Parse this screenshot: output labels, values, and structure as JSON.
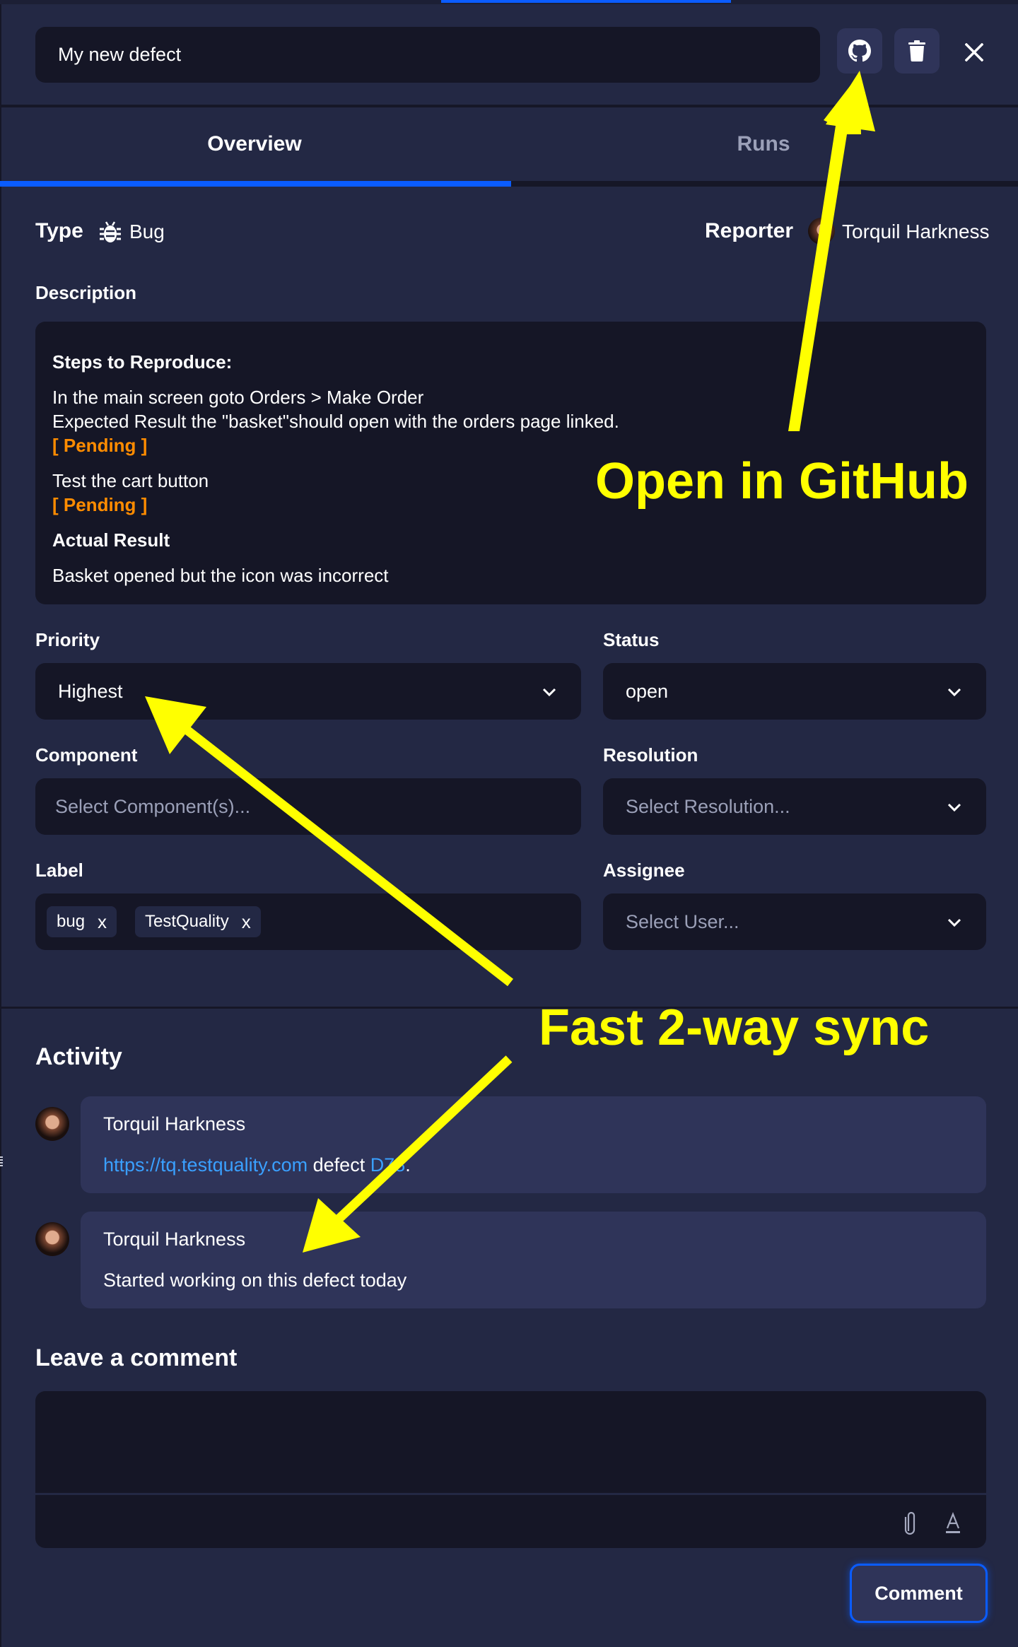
{
  "header": {
    "title_value": "My new defect",
    "github_button": "github-icon",
    "delete_button": "trash-icon",
    "close_button": "close-icon"
  },
  "tabs": [
    {
      "label": "Overview",
      "active": true
    },
    {
      "label": "Runs",
      "active": false
    }
  ],
  "overview": {
    "type_label": "Type",
    "type_value": "Bug",
    "type_icon": "bug-icon",
    "reporter_label": "Reporter",
    "reporter_name": "Torquil Harkness",
    "description_label": "Description",
    "description": {
      "steps_heading": "Steps to Reproduce:",
      "step1_line1": "In the main screen goto Orders > Make Order",
      "step1_line2": "Expected Result the \"basket\"should open with the orders page linked.",
      "step1_status": "[ Pending ]",
      "step2_line1": "Test the cart button",
      "step2_status": "[ Pending ]",
      "actual_heading": "Actual Result",
      "actual_text": "Basket opened but the icon was incorrect"
    },
    "fields": {
      "priority": {
        "label": "Priority",
        "value": "Highest"
      },
      "status": {
        "label": "Status",
        "value": "open"
      },
      "component": {
        "label": "Component",
        "placeholder": "Select Component(s)..."
      },
      "resolution": {
        "label": "Resolution",
        "placeholder": "Select Resolution..."
      },
      "label": {
        "label": "Label",
        "chips": [
          "bug",
          "TestQuality"
        ],
        "remove_glyph": "x"
      },
      "assignee": {
        "label": "Assignee",
        "placeholder": "Select User..."
      }
    }
  },
  "activity": {
    "title": "Activity",
    "items": [
      {
        "author": "Torquil Harkness",
        "link_text": "https://tq.testquality.com",
        "middle_text": " defect ",
        "ref": "D78",
        "tail": "."
      },
      {
        "author": "Torquil Harkness",
        "text": "Started working on this defect today"
      }
    ]
  },
  "comment_form": {
    "title": "Leave a comment",
    "textarea_value": "",
    "attach_icon": "paperclip-icon",
    "format_icon": "text-format-icon",
    "submit_label": "Comment"
  },
  "annotations": {
    "github": "Open in GitHub",
    "sync": "Fast 2-way sync",
    "color": "#ffff00"
  },
  "colors": {
    "accent": "#0a5cff",
    "panel_bg": "#232844",
    "input_bg": "#151626",
    "card_bg": "#2f3459",
    "pending": "#ff8c00",
    "link": "#3aa0ff"
  }
}
